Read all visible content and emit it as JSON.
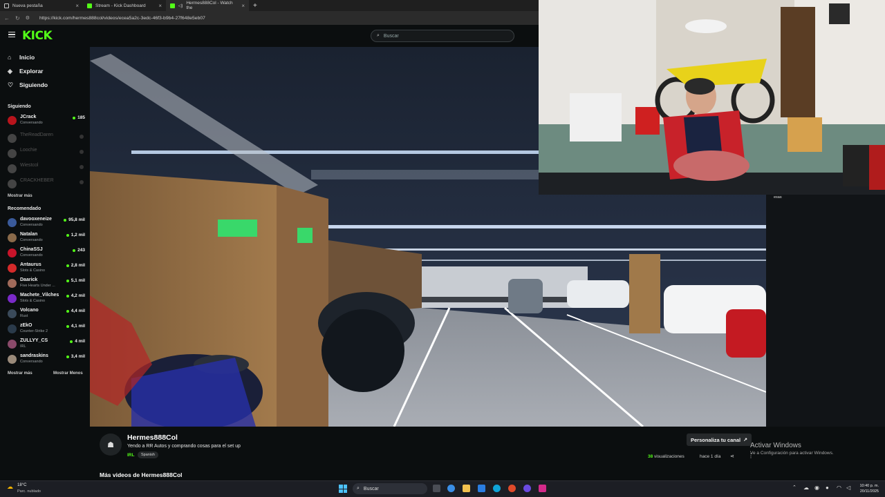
{
  "browser": {
    "tabs": [
      {
        "label": "Nueva pestaña",
        "icon": "blank-tab-icon"
      },
      {
        "label": "Stream - Kick Dashboard",
        "icon": "kick-icon"
      },
      {
        "label": "Hermes888Col - Watch the",
        "icon": "kick-icon"
      }
    ],
    "url": "https://kick.com/hermes888col/videos/ecea5a2c-3edc-46f3-b9b4-27f648e5eb07"
  },
  "header": {
    "logo": "KICK",
    "search_placeholder": "Buscar"
  },
  "sidebar": {
    "nav": [
      {
        "label": "Inicio",
        "icon": "home-icon"
      },
      {
        "label": "Explorar",
        "icon": "compass-icon"
      },
      {
        "label": "Siguiendo",
        "icon": "heart-icon"
      }
    ],
    "following_title": "Siguiendo",
    "following": [
      {
        "name": "JCrack",
        "sub": "Conversando",
        "viewers": "185",
        "online": true,
        "color": "#b8141c"
      },
      {
        "name": "TheReadDaren",
        "sub": "",
        "viewers": "",
        "online": false,
        "color": "#444444"
      },
      {
        "name": "Loochie",
        "sub": "",
        "viewers": "",
        "online": false,
        "color": "#444444"
      },
      {
        "name": "Wiestcol",
        "sub": "",
        "viewers": "",
        "online": false,
        "color": "#444444"
      },
      {
        "name": "CRACKHEBER",
        "sub": "",
        "viewers": "",
        "online": false,
        "color": "#444444"
      }
    ],
    "show_more_following": "Mostrar más",
    "recommended_title": "Recomendado",
    "recommended": [
      {
        "name": "davooxeneize",
        "sub": "Conversando",
        "viewers": "95,8 mil",
        "color": "#3a5a9a"
      },
      {
        "name": "Natalan",
        "sub": "Conversando",
        "viewers": "1,2 mil",
        "color": "#8a6a4a"
      },
      {
        "name": "ChinaSSJ",
        "sub": "Conversando",
        "viewers": "243",
        "color": "#c8142a"
      },
      {
        "name": "Antaurus",
        "sub": "Slots & Casino",
        "viewers": "2,8 mil",
        "color": "#d42a2a"
      },
      {
        "name": "Daarick",
        "sub": "Five Hearts Under ...",
        "viewers": "5,1 mil",
        "color": "#a06a5a"
      },
      {
        "name": "Machete_Vilches",
        "sub": "Slots & Casino",
        "viewers": "4,2 mil",
        "color": "#7a2ac8"
      },
      {
        "name": "Volcano",
        "sub": "Rust",
        "viewers": "4,4 mil",
        "color": "#3a4a5a"
      },
      {
        "name": "zEkO",
        "sub": "Counter-Strike 2",
        "viewers": "4,1 mil",
        "color": "#2a3a4a"
      },
      {
        "name": "ZULLYY_CS",
        "sub": "IRL",
        "viewers": "4 mil",
        "color": "#8a4a6a"
      },
      {
        "name": "sandraskins",
        "sub": "Conversando",
        "viewers": "3,4 mil",
        "color": "#9a8a7a"
      }
    ],
    "show_more": "Mostrar más",
    "show_less": "Mostrar Menos"
  },
  "video": {
    "cam_tag": "esas"
  },
  "info": {
    "channel": "Hermes888Col",
    "title": "Yendo a RR Autos y comprando cosas para el set up",
    "category": "IRL",
    "language": "Spanish",
    "customize_button": "Personaliza tu canal",
    "views_count": "38",
    "views_label": "visualizaciones",
    "ago": "hace 1 día",
    "more_videos": "Más videos de Hermes888Col"
  },
  "windows": {
    "activate_title": "Activar Windows",
    "activate_sub": "Ve a Configuración para activar Windows.",
    "weather_temp": "18°C",
    "weather_desc": "Parc. nublado",
    "search": "Buscar",
    "time": "10:40 p. m.",
    "date": "20/11/2025"
  },
  "colors": {
    "accent": "#53fc18",
    "background": "#0b0e0f"
  }
}
